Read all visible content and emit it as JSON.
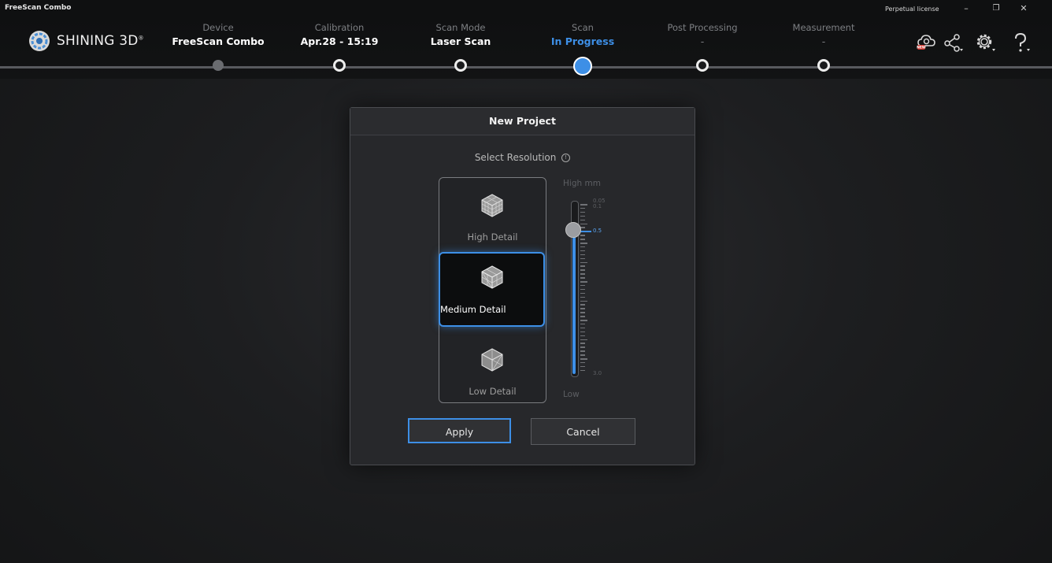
{
  "window": {
    "app_name": "FreeScan Combo",
    "license": "Perpetual license",
    "minimize": "–",
    "maximize": "❐",
    "close": "✕"
  },
  "brand": {
    "name": "SHINING 3D",
    "mark": "®"
  },
  "workflow": {
    "steps": [
      {
        "label": "Device",
        "value": "FreeScan Combo",
        "state": "done"
      },
      {
        "label": "Calibration",
        "value": "Apr.28 - 15:19",
        "state": "next"
      },
      {
        "label": "Scan Mode",
        "value": "Laser Scan",
        "state": "next"
      },
      {
        "label": "Scan",
        "value": "In Progress",
        "state": "current"
      },
      {
        "label": "Post Processing",
        "value": "-",
        "state": "pending"
      },
      {
        "label": "Measurement",
        "value": "-",
        "state": "pending"
      }
    ]
  },
  "toolbar": {
    "icons": [
      "cloud-update-icon",
      "share-icon",
      "settings-icon",
      "help-icon"
    ],
    "update_badge": "NEW"
  },
  "dialog": {
    "title": "New Project",
    "select_label": "Select Resolution",
    "info_glyph": "!",
    "options": [
      {
        "label": "High Detail",
        "selected": false
      },
      {
        "label": "Medium Detail",
        "selected": true
      },
      {
        "label": "Low Detail",
        "selected": false
      }
    ],
    "slider": {
      "high_label": "High",
      "unit": "mm",
      "low_label": "Low",
      "tick_labels": [
        "0.05",
        "0.1",
        "0.5",
        "3.0"
      ],
      "value": "0.5"
    },
    "apply_label": "Apply",
    "cancel_label": "Cancel"
  },
  "colors": {
    "accent": "#3d8fe6",
    "background": "#1d1e20",
    "dialog": "#27282b"
  }
}
